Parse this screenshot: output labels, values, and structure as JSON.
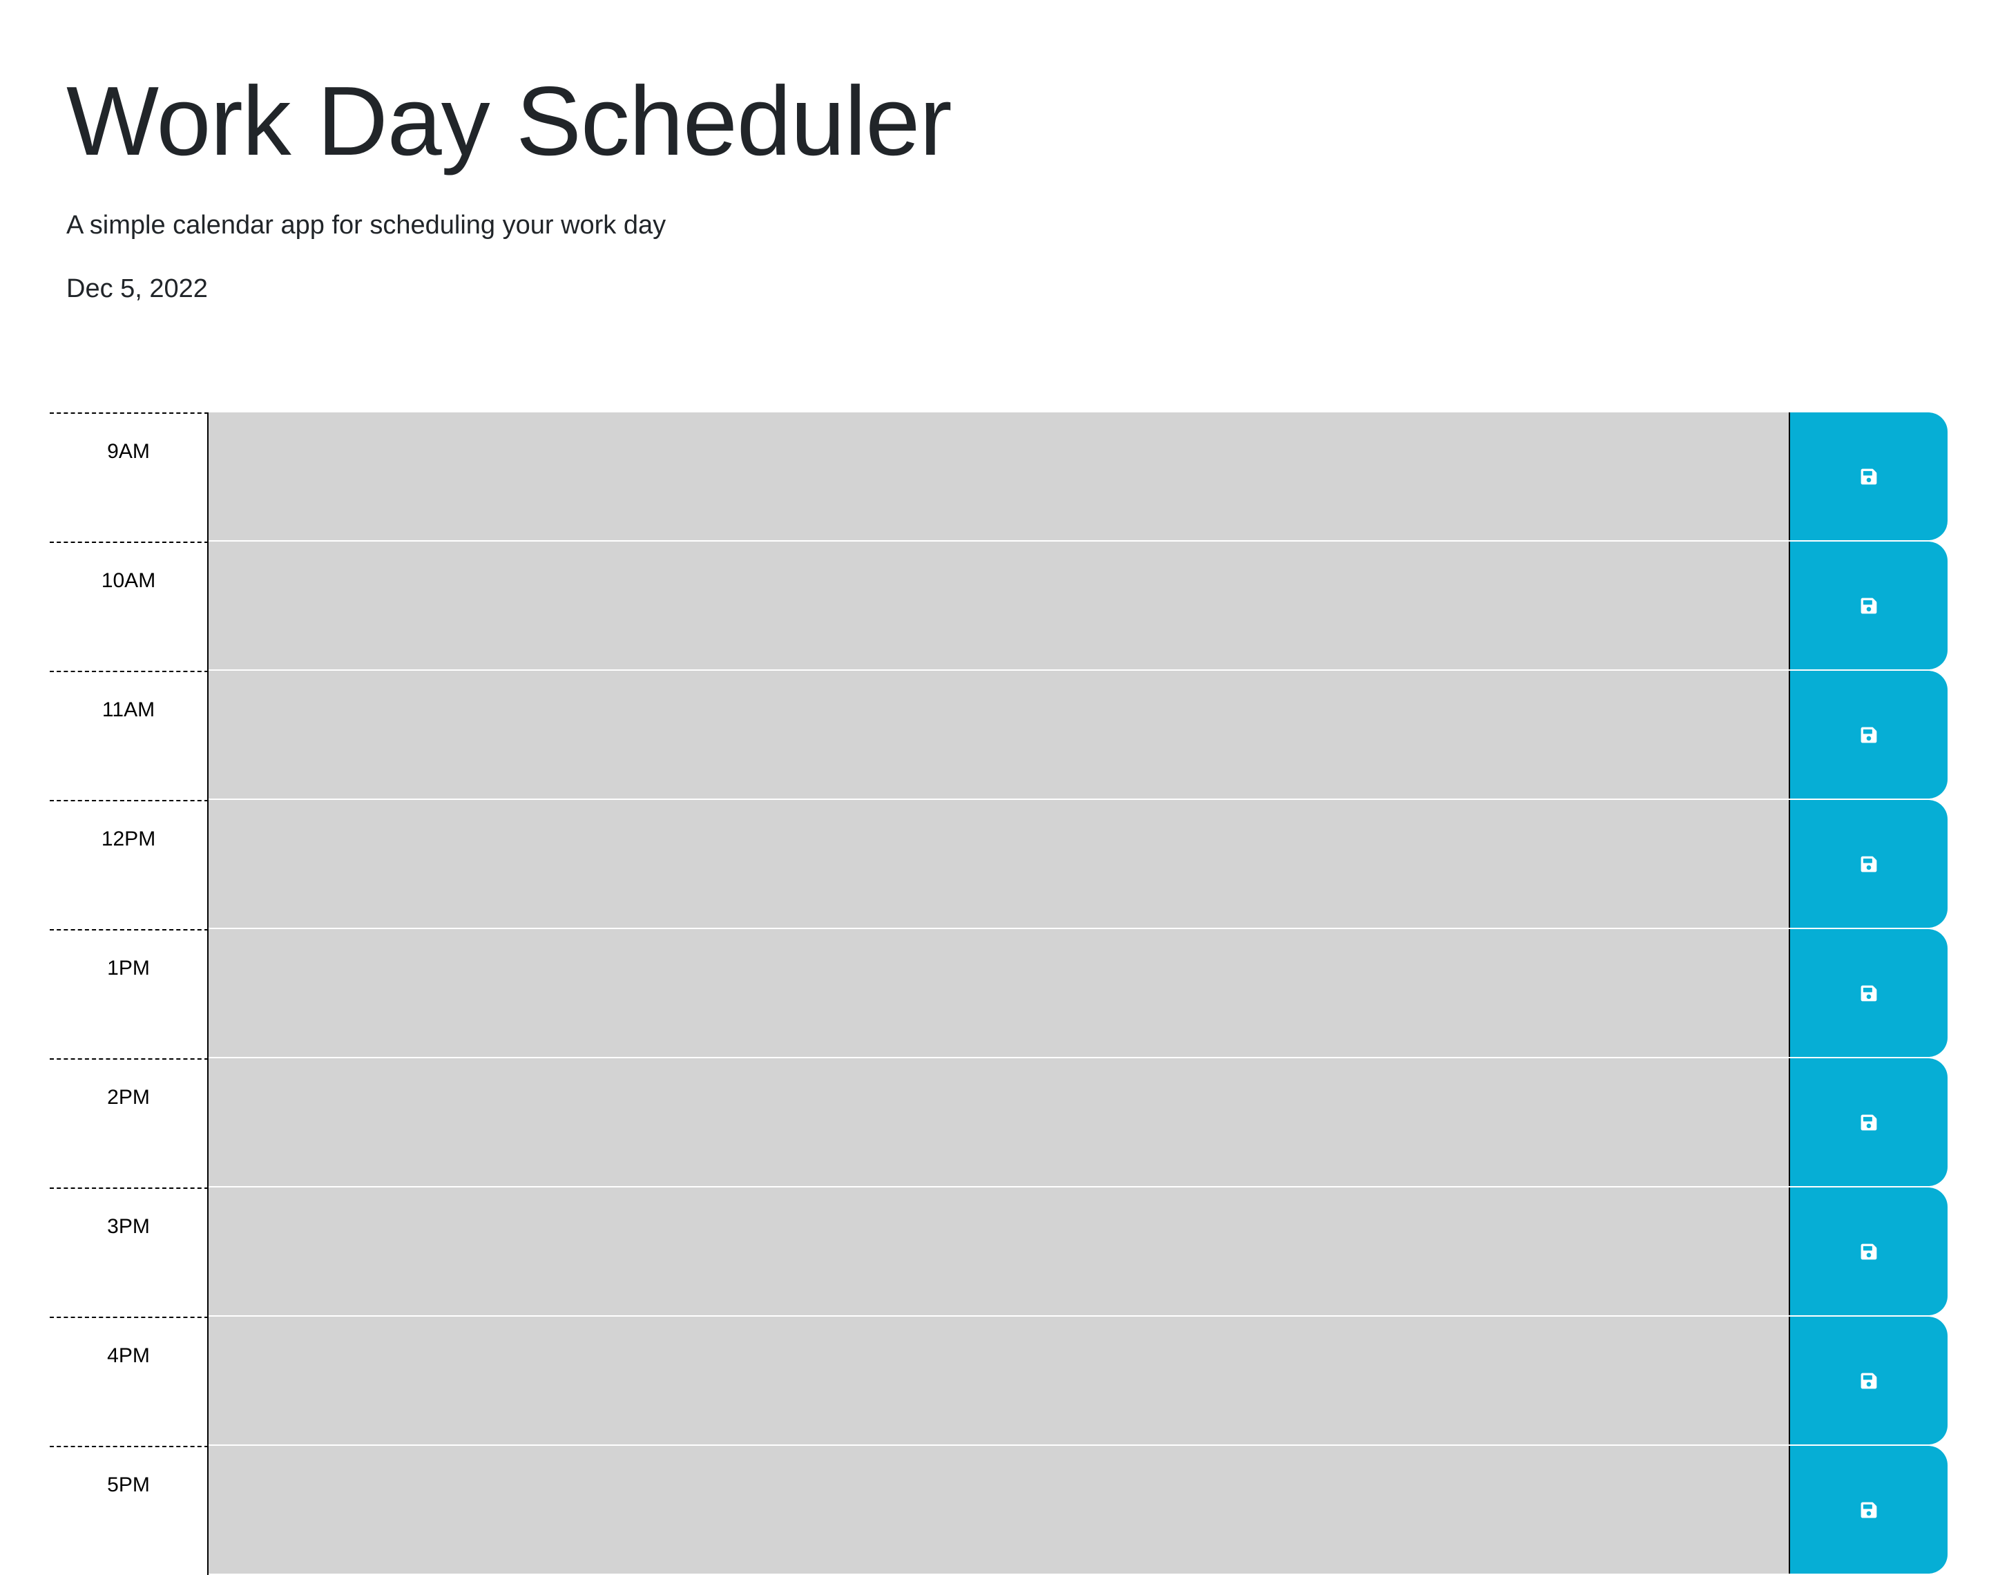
{
  "header": {
    "title": "Work Day Scheduler",
    "lead": "A simple calendar app for scheduling your work day",
    "current_day": "Dec 5, 2022"
  },
  "colors": {
    "past": "#d3d3d3",
    "save_button": "#06aed5",
    "save_icon": "#ffffff"
  },
  "time_blocks": [
    {
      "hour": "9AM",
      "description": "",
      "state": "past",
      "save_icon": "save-icon"
    },
    {
      "hour": "10AM",
      "description": "",
      "state": "past",
      "save_icon": "save-icon"
    },
    {
      "hour": "11AM",
      "description": "",
      "state": "past",
      "save_icon": "save-icon"
    },
    {
      "hour": "12PM",
      "description": "",
      "state": "past",
      "save_icon": "save-icon"
    },
    {
      "hour": "1PM",
      "description": "",
      "state": "past",
      "save_icon": "save-icon"
    },
    {
      "hour": "2PM",
      "description": "",
      "state": "past",
      "save_icon": "save-icon"
    },
    {
      "hour": "3PM",
      "description": "",
      "state": "past",
      "save_icon": "save-icon"
    },
    {
      "hour": "4PM",
      "description": "",
      "state": "past",
      "save_icon": "save-icon"
    },
    {
      "hour": "5PM",
      "description": "",
      "state": "past",
      "save_icon": "save-icon"
    }
  ]
}
